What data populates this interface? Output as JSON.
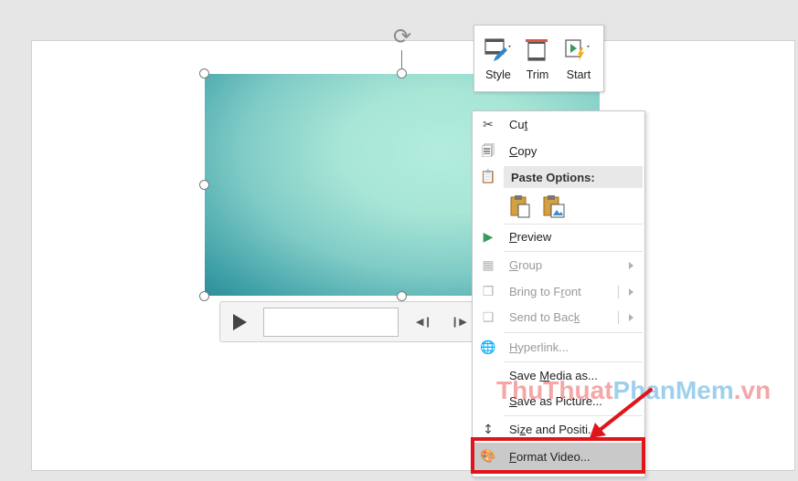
{
  "mini_toolbar": {
    "style_label": "Style",
    "trim_label": "Trim",
    "start_label": "Start"
  },
  "context_menu": {
    "cut": {
      "pre": "Cu",
      "key": "t",
      "post": ""
    },
    "copy": {
      "pre": "",
      "key": "C",
      "post": "opy"
    },
    "paste_options": "Paste Options:",
    "preview": {
      "pre": "",
      "key": "P",
      "post": "review"
    },
    "group": {
      "pre": "",
      "key": "G",
      "post": "roup"
    },
    "bring_to_front": {
      "pre": "Bring to F",
      "key": "r",
      "post": "ont"
    },
    "send_to_back": {
      "pre": "Send to Bac",
      "key": "k",
      "post": ""
    },
    "hyperlink": {
      "pre": "",
      "key": "H",
      "post": "yperlink..."
    },
    "save_media_as": {
      "pre": "Save ",
      "key": "M",
      "post": "edia as..."
    },
    "save_as_picture": {
      "pre": "",
      "key": "S",
      "post": "ave as Picture..."
    },
    "size_and_position": {
      "pre": "Si",
      "key": "z",
      "post": "e and Positi..."
    },
    "format_video": {
      "pre": "",
      "key": "F",
      "post": "ormat Video..."
    }
  },
  "watermark": {
    "part1": "ThuThuat",
    "part2": "PhanMem",
    "part3": ".vn"
  },
  "colors": {
    "highlight": "#e0151b",
    "menu_hover": "#c9c9c9"
  }
}
